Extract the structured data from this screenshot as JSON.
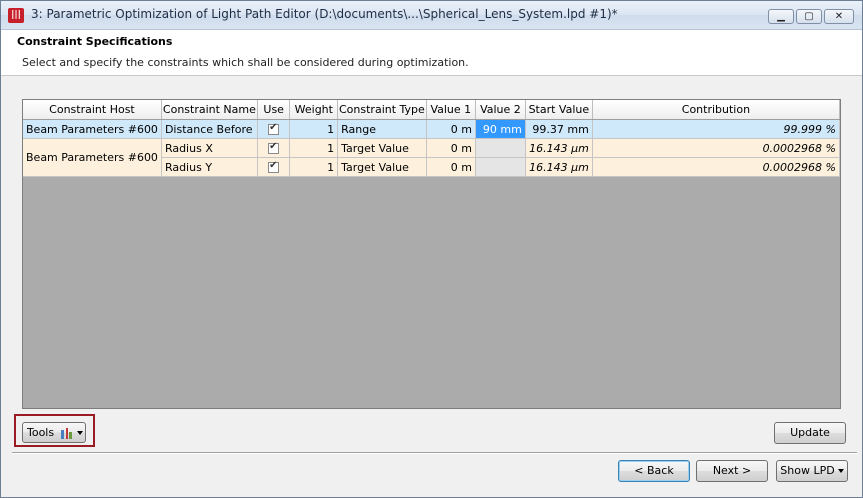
{
  "window": {
    "title": "3: Parametric Optimization of Light Path Editor (D:\\documents\\...\\Spherical_Lens_System.lpd #1)*",
    "app_icon": "vl-logo-icon",
    "buttons": {
      "minimize": "minimize-icon",
      "maximize": "maximize-icon",
      "close": "close-icon"
    }
  },
  "header": {
    "title": "Constraint Specifications",
    "subtitle": "Select and specify the constraints which shall be considered during optimization."
  },
  "table": {
    "columns": [
      "Constraint Host",
      "Constraint Name",
      "Use",
      "Weight",
      "Constraint Type",
      "Value 1",
      "Value 2",
      "Start Value",
      "Contribution"
    ],
    "rows": [
      {
        "host": "Beam Parameters #600",
        "name": "Distance Before",
        "use": true,
        "weight": "1",
        "type": "Range",
        "value1": "0 m",
        "value2": "90 mm",
        "start": "99.37 mm",
        "contribution": "99.999 %"
      },
      {
        "host": "Beam Parameters #600",
        "name": "Radius X",
        "use": true,
        "weight": "1",
        "type": "Target Value",
        "value1": "0 m",
        "value2": "",
        "start": "16.143 µm",
        "contribution": "0.0002968 %"
      },
      {
        "host": "",
        "name": "Radius Y",
        "use": true,
        "weight": "1",
        "type": "Target Value",
        "value1": "0 m",
        "value2": "",
        "start": "16.143 µm",
        "contribution": "0.0002968 %"
      }
    ]
  },
  "buttons": {
    "tools": "Tools",
    "update": "Update",
    "back": "< Back",
    "next": "Next >",
    "show_lpd": "Show LPD"
  },
  "colors": {
    "selected_row": "#cfe8fa",
    "alt_row": "#fdf1dd",
    "highlight_cell": "#3399ff",
    "tools_frame": "#9b1b25"
  }
}
